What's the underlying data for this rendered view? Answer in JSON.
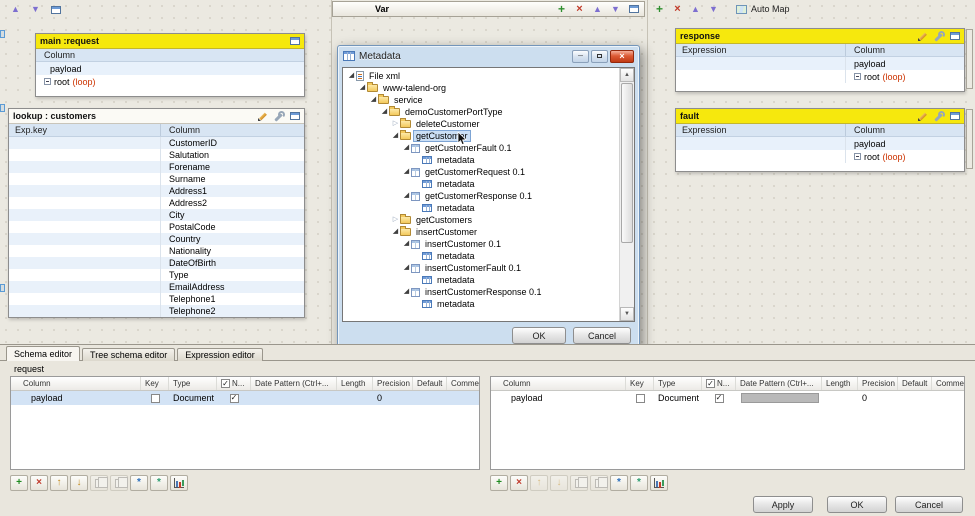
{
  "icons": {
    "plus": "+",
    "remove": "×",
    "up": "▲",
    "down": "▼",
    "minimize": "─",
    "check": "✓",
    "expander_open": "◢",
    "expander_closed": "▷",
    "scroll_up": "▲",
    "scroll_down": "▼"
  },
  "top": {
    "var_label": "Var",
    "auto_map_label": "Auto Map"
  },
  "main_request": {
    "title": "main :request",
    "column_header": "Column",
    "payload_label": "payload",
    "root_label": "root",
    "loop_label": "(loop)"
  },
  "lookup": {
    "title": "lookup : customers",
    "key_header": "Exp.key",
    "column_header": "Column",
    "columns": [
      "CustomerID",
      "Salutation",
      "Forename",
      "Surname",
      "Address1",
      "Address2",
      "City",
      "PostalCode",
      "Country",
      "Nationality",
      "DateOfBirth",
      "Type",
      "EmailAddress",
      "Telephone1",
      "Telephone2"
    ]
  },
  "response": {
    "title": "response",
    "expression_header": "Expression",
    "column_header": "Column",
    "payload_label": "payload",
    "root_label": "root",
    "loop_label": "(loop)"
  },
  "fault": {
    "title": "fault",
    "expression_header": "Expression",
    "column_header": "Column",
    "payload_label": "payload",
    "root_label": "root",
    "loop_label": "(loop)"
  },
  "dialog": {
    "title": "Metadata",
    "ok_label": "OK",
    "cancel_label": "Cancel",
    "tree": [
      {
        "label": "File xml",
        "indent": 0,
        "icon": "xml-file",
        "state": "expanded"
      },
      {
        "label": "www-talend-org",
        "indent": 1,
        "icon": "folder",
        "state": "expanded"
      },
      {
        "label": "service",
        "indent": 2,
        "icon": "folder",
        "state": "expanded"
      },
      {
        "label": "demoCustomerPortType",
        "indent": 3,
        "icon": "folder",
        "state": "expanded"
      },
      {
        "label": "deleteCustomer",
        "indent": 4,
        "icon": "folder",
        "state": "collapsed"
      },
      {
        "label": "getCustomer",
        "indent": 4,
        "icon": "folder",
        "state": "expanded",
        "selected": true,
        "cursor": true
      },
      {
        "label": "getCustomerFault 0.1",
        "indent": 5,
        "icon": "schema",
        "state": "expanded"
      },
      {
        "label": "metadata",
        "indent": 6,
        "icon": "table",
        "state": "leaf"
      },
      {
        "label": "getCustomerRequest 0.1",
        "indent": 5,
        "icon": "schema",
        "state": "expanded"
      },
      {
        "label": "metadata",
        "indent": 6,
        "icon": "table",
        "state": "leaf"
      },
      {
        "label": "getCustomerResponse 0.1",
        "indent": 5,
        "icon": "schema",
        "state": "expanded"
      },
      {
        "label": "metadata",
        "indent": 6,
        "icon": "table",
        "state": "leaf"
      },
      {
        "label": "getCustomers",
        "indent": 4,
        "icon": "folder",
        "state": "collapsed"
      },
      {
        "label": "insertCustomer",
        "indent": 4,
        "icon": "folder",
        "state": "expanded"
      },
      {
        "label": "insertCustomer 0.1",
        "indent": 5,
        "icon": "schema",
        "state": "expanded"
      },
      {
        "label": "metadata",
        "indent": 6,
        "icon": "table",
        "state": "leaf"
      },
      {
        "label": "insertCustomerFault 0.1",
        "indent": 5,
        "icon": "schema",
        "state": "expanded"
      },
      {
        "label": "metadata",
        "indent": 6,
        "icon": "table",
        "state": "leaf"
      },
      {
        "label": "insertCustomerResponse 0.1",
        "indent": 5,
        "icon": "schema",
        "state": "expanded"
      },
      {
        "label": "metadata",
        "indent": 6,
        "icon": "table",
        "state": "leaf"
      }
    ]
  },
  "bottom": {
    "tabs": [
      {
        "label": "Schema editor",
        "active": true
      },
      {
        "label": "Tree schema editor",
        "active": false
      },
      {
        "label": "Expression editor",
        "active": false
      }
    ],
    "request_label": "request",
    "schema_headers": [
      {
        "label": "Column"
      },
      {
        "label": "Key"
      },
      {
        "label": "Type"
      },
      {
        "label": "N...",
        "checkbox": true
      },
      {
        "label": "Date Pattern (Ctrl+..."
      },
      {
        "label": "Length"
      },
      {
        "label": "Precision"
      },
      {
        "label": "Default"
      },
      {
        "label": "Comment"
      }
    ],
    "left_table": {
      "selected": true,
      "date_pattern_disabled": false,
      "row": {
        "column": "payload",
        "key": false,
        "type": "Document",
        "nullable": true,
        "date_pattern": "",
        "length": "",
        "precision": "0",
        "default_value": "",
        "comment": ""
      }
    },
    "right_table": {
      "selected": false,
      "date_pattern_disabled": true,
      "row": {
        "column": "payload",
        "key": false,
        "type": "Document",
        "nullable": true,
        "date_pattern": "",
        "length": "",
        "precision": "0",
        "default_value": "",
        "comment": ""
      }
    },
    "left_toolbar": [
      {
        "name": "add-column-button",
        "glyph": "+",
        "color": "#1f8a1f"
      },
      {
        "name": "remove-column-button",
        "glyph": "×",
        "color": "#c0392b"
      },
      {
        "name": "move-up-button",
        "glyph": "↑",
        "color": "#c28a1e"
      },
      {
        "name": "move-down-button",
        "glyph": "↓",
        "color": "#c28a1e"
      },
      {
        "name": "copy-button",
        "kind": "copy",
        "disabled": true
      },
      {
        "name": "paste-button",
        "kind": "copy",
        "disabled": true
      },
      {
        "name": "import-schema-button",
        "glyph": "*",
        "color": "#2a6fbd"
      },
      {
        "name": "export-schema-button",
        "glyph": "*",
        "color": "#2a9d6f"
      },
      {
        "name": "columns-view-button",
        "kind": "chart"
      }
    ],
    "right_toolbar": [
      {
        "name": "add-column-button",
        "glyph": "+",
        "color": "#1f8a1f"
      },
      {
        "name": "remove-column-button",
        "glyph": "×",
        "color": "#c0392b"
      },
      {
        "name": "move-up-button",
        "glyph": "↑",
        "color": "#c28a1e",
        "disabled": true
      },
      {
        "name": "move-down-button",
        "glyph": "↓",
        "color": "#c28a1e",
        "disabled": true
      },
      {
        "name": "copy-button",
        "kind": "copy",
        "disabled": true
      },
      {
        "name": "paste-button",
        "kind": "copy",
        "disabled": true
      },
      {
        "name": "import-schema-button",
        "glyph": "*",
        "color": "#2a6fbd"
      },
      {
        "name": "export-schema-button",
        "glyph": "*",
        "color": "#2a9d6f"
      },
      {
        "name": "columns-view-button",
        "kind": "chart"
      }
    ],
    "apply_label": "Apply",
    "ok_label": "OK",
    "cancel_label": "Cancel"
  }
}
